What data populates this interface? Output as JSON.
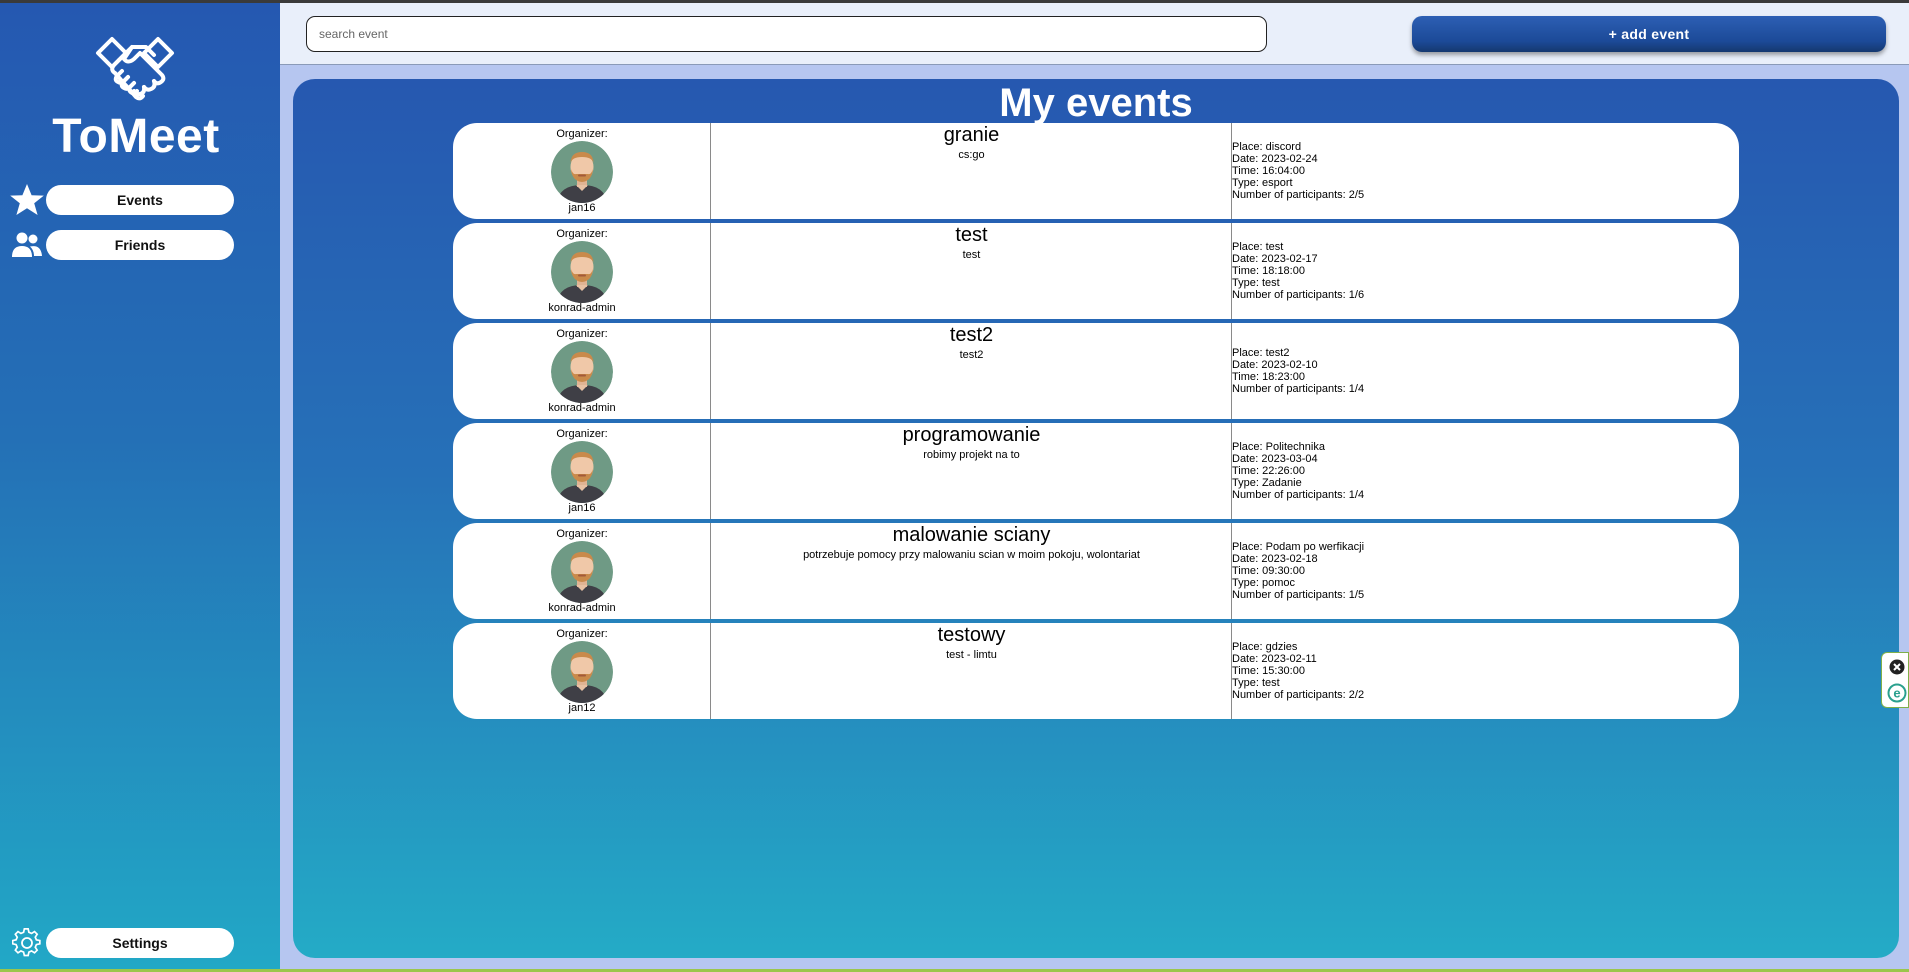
{
  "sidebar": {
    "brand": "ToMeet",
    "nav": [
      {
        "label": "Events",
        "icon": "star-icon"
      },
      {
        "label": "Friends",
        "icon": "users-icon"
      }
    ],
    "settings_label": "Settings",
    "settings_icon": "gear-icon",
    "logo_icon": "handshake-icon"
  },
  "topbar": {
    "search_placeholder": "search event",
    "add_event_label": "+ add event"
  },
  "main": {
    "title": "My events",
    "organizer_label": "Organizer:",
    "events": [
      {
        "organizer": "jan16",
        "title": "granie",
        "description": "cs:go",
        "details": [
          "Place: discord",
          "Date: 2023-02-24",
          "Time: 16:04:00",
          "Type: esport",
          "Number of participants: 2/5"
        ]
      },
      {
        "organizer": "konrad-admin",
        "title": "test",
        "description": "test",
        "details": [
          "Place: test",
          "Date: 2023-02-17",
          "Time: 18:18:00",
          "Type: test",
          "Number of participants: 1/6"
        ]
      },
      {
        "organizer": "konrad-admin",
        "title": "test2",
        "description": "test2",
        "details": [
          "Place: test2",
          "Date: 2023-02-10",
          "Time: 18:23:00",
          "Number of participants: 1/4"
        ]
      },
      {
        "organizer": "jan16",
        "title": "programowanie",
        "description": "robimy projekt na to",
        "details": [
          "Place: Politechnika",
          "Date: 2023-03-04",
          "Time: 22:26:00",
          "Type: Zadanie",
          "Number of participants: 1/4"
        ]
      },
      {
        "organizer": "konrad-admin",
        "title": "malowanie sciany",
        "description": "potrzebuje pomocy przy malowaniu scian w moim pokoju, wolontariat",
        "details": [
          "Place: Podam po werfikacji",
          "Date: 2023-02-18",
          "Time: 09:30:00",
          "Type: pomoc",
          "Number of participants: 1/5"
        ]
      },
      {
        "organizer": "jan12",
        "title": "testowy",
        "description": "test - limtu",
        "details": [
          "Place: gdzies",
          "Date: 2023-02-11",
          "Time: 15:30:00",
          "Type: test",
          "Number of participants: 2/2"
        ]
      }
    ]
  },
  "colors": {
    "accent": "#2558b1",
    "accent_bottom": "#22a8c6",
    "button_dark": "#1c4a98"
  }
}
